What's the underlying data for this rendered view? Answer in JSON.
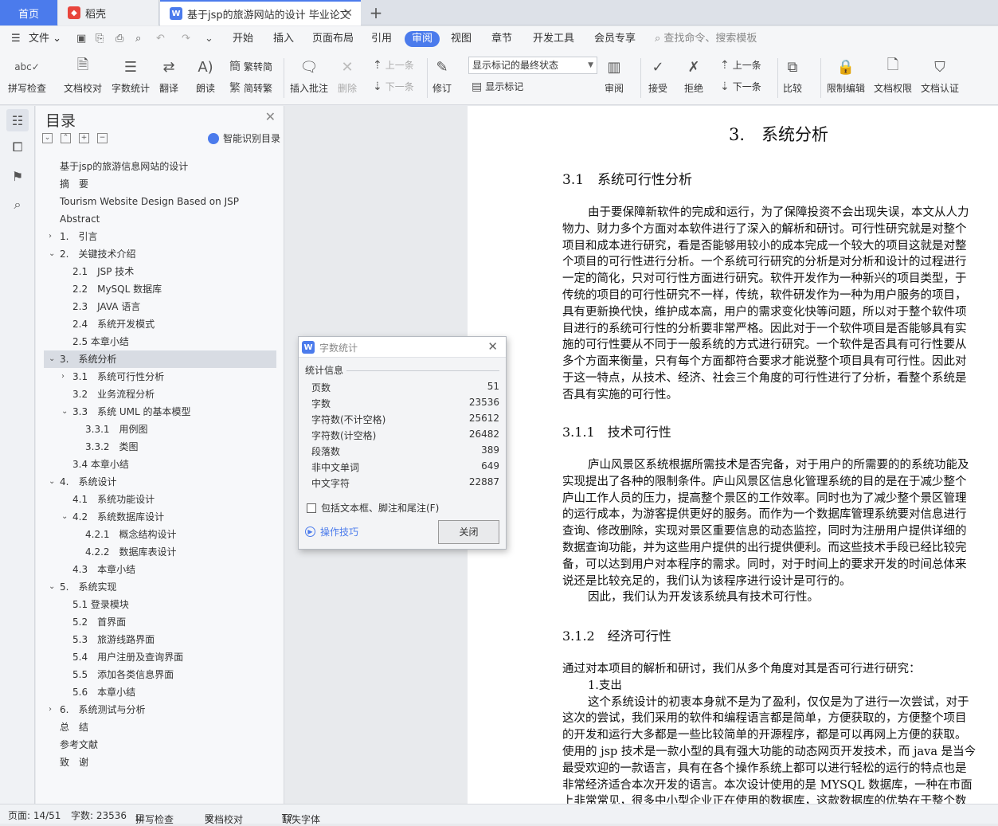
{
  "tabs": {
    "home": "首页",
    "daoke": "稻壳",
    "doc": "基于jsp的旅游网站的设计 毕业论文",
    "doc_icon": "W"
  },
  "menu": {
    "file": "文件",
    "items": [
      "开始",
      "插入",
      "页面布局",
      "引用",
      "审阅",
      "视图",
      "章节",
      "开发工具",
      "会员专享"
    ],
    "search": "查找命令、搜索模板"
  },
  "toolbar": {
    "spellcheck": "拼写检查",
    "doc_proof": "文档校对",
    "word_count": "字数统计",
    "translate": "翻译",
    "read_aloud": "朗读",
    "trad": "繁转简",
    "simp": "简转繁",
    "insert_comment": "插入批注",
    "delete": "删除",
    "prev1": "上一条",
    "next1": "下一条",
    "revise": "修订",
    "markup_select": "显示标记的最终状态",
    "show_markup": "显示标记",
    "review": "审阅",
    "accept": "接受",
    "reject": "拒绝",
    "prev2": "上一条",
    "next2": "下一条",
    "compare": "比较",
    "restrict": "限制编辑",
    "permission": "文档权限",
    "certify": "文档认证"
  },
  "toc": {
    "title": "目录",
    "smart": "智能识别目录",
    "items": [
      "基于jsp的旅游信息网站的设计",
      "摘　要",
      "Tourism Website Design Based on JSP",
      "Abstract",
      "1.　引言",
      "2.　关键技术介绍",
      "2.1　JSP 技术",
      "2.2　MySQL 数据库",
      "2.3　JAVA 语言",
      "2.4　系统开发模式",
      "2.5 本章小结",
      "3.　系统分析",
      "3.1　系统可行性分析",
      "3.2　业务流程分析",
      "3.3　系统 UML 的基本模型",
      "3.3.1　用例图",
      "3.3.2　类图",
      "3.4 本章小结",
      "4.　系统设计",
      "4.1　系统功能设计",
      "4.2　系统数据库设计",
      "4.2.1　概念结构设计",
      "4.2.2　数据库表设计",
      "4.3　本章小结",
      "5.　系统实现",
      "5.1 登录模块",
      "5.2　首界面",
      "5.3　旅游线路界面",
      "5.4　用户注册及查询界面",
      "5.5　添加各类信息界面",
      "5.6　本章小结",
      "6.　系统测试与分析",
      "总　结",
      "参考文献",
      "致　谢"
    ]
  },
  "dialog": {
    "title": "字数统计",
    "icon": "W",
    "section": "统计信息",
    "stats": [
      {
        "label": "页数",
        "value": "51"
      },
      {
        "label": "字数",
        "value": "23536"
      },
      {
        "label": "字符数(不计空格)",
        "value": "25612"
      },
      {
        "label": "字符数(计空格)",
        "value": "26482"
      },
      {
        "label": "段落数",
        "value": "389"
      },
      {
        "label": "非中文单词",
        "value": "649"
      },
      {
        "label": "中文字符",
        "value": "22887"
      }
    ],
    "checkbox": "包括文本框、脚注和尾注(F)",
    "tips": "操作技巧",
    "close": "关闭"
  },
  "doc": {
    "h1": "3.　系统分析",
    "h2": "3.1　系统可行性分析",
    "p1": [
      "由于要保障新软件的完成和运行，为了保障投资不会出现失误，本文从人力",
      "物力、财力多个方面对本软件进行了深入的解析和研讨。可行性研究就是对整个",
      "项目和成本进行研究，看是否能够用较小的成本完成一个较大的项目这就是对整",
      "个项目的可行性进行分析。一个系统可行研究的分析是对分析和设计的过程进行",
      "一定的简化，只对可行性方面进行研究。软件开发作为一种新兴的项目类型，于",
      "传统的项目的可行性研究不一样，传统，软件研发作为一种为用户服务的项目，",
      "具有更新换代快，维护成本高，用户的需求变化快等问题，所以对于整个软件项",
      "目进行的系统可行性的分析要非常严格。因此对于一个软件项目是否能够具有实",
      "施的可行性要从不同于一般系统的方式进行研究。一个软件是否具有可行性要从",
      "多个方面来衡量，只有每个方面都符合要求才能说整个项目具有可行性。因此对",
      "于这一特点，从技术、经济、社会三个角度的可行性进行了分析，看整个系统是",
      "否具有实施的可行性。"
    ],
    "h3a": "3.1.1　技术可行性",
    "p2": [
      "庐山风景区系统根据所需技术是否完备，对于用户的所需要的的系统功能及",
      "实现提出了各种的限制条件。庐山风景区信息化管理系统的目的是在于减少整个",
      "庐山工作人员的压力，提高整个景区的工作效率。同时也为了减少整个景区管理",
      "的运行成本，为游客提供更好的服务。而作为一个数据库管理系统要对信息进行",
      "查询、修改删除，实现对景区重要信息的动态监控，同时为注册用户提供详细的",
      "数据查询功能，并为这些用户提供的出行提供便利。而这些技术手段已经比较完",
      "备，可以达到用户对本程序的需求。同时，对于时间上的要求开发的时间总体来",
      "说还是比较充足的，我们认为该程序进行设计是可行的。",
      "因此，我们认为开发该系统具有技术可行性。"
    ],
    "h3b": "3.1.2　经济可行性",
    "p3": [
      "通过对本项目的解析和研讨，我们从多个角度对其是否可行进行研究：",
      "1.支出",
      "这个系统设计的初衷本身就不是为了盈利，仅仅是为了进行一次尝试，对于",
      "这次的尝试，我们采用的软件和编程语言都是简单，方便获取的，方便整个项目",
      "的开发和运行大多都是一些比较简单的开源程序，都是可以再网上方便的获取。",
      "使用的 jsp 技术是一款小型的具有强大功能的动态网页开发技术，而 java 是当今",
      "最受欢迎的一款语言，具有在各个操作系统上都可以进行轻松的运行的特点也是",
      "非常经济适合本次开发的语言。本次设计使用的是 MYSQL 数据库，一种在市面",
      "上非常常见，很多中小型企业正在使用的数据库，这款数据库的优势在于整个数"
    ]
  },
  "status": {
    "page": "页面: 14/51",
    "words": "字数: 23536",
    "spell": "拼写检查",
    "proof": "文档校对",
    "font": "缺失字体"
  },
  "colors": {
    "accent": "#4b7bec",
    "daoke_icon": "#e8453c"
  }
}
